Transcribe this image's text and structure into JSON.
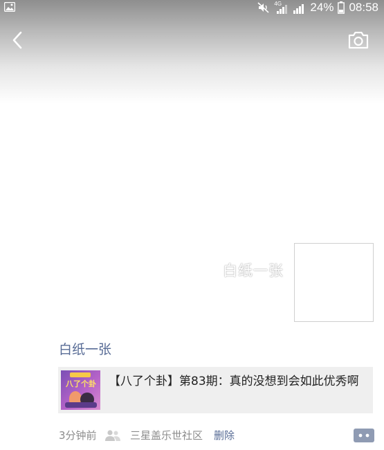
{
  "status_bar": {
    "network": "4G",
    "battery_percent": "24%",
    "time": "08:58",
    "left_icon": "image-icon",
    "icons": [
      "mute-icon",
      "signal-icon",
      "signal-2g-icon",
      "battery-icon"
    ]
  },
  "header": {
    "back_icon": "chevron-left-icon",
    "camera_icon": "camera-icon"
  },
  "cover": {
    "user_name": "白纸一张"
  },
  "post": {
    "author": "白纸一张",
    "share_card": {
      "title": "【八了个卦】第83期：真的没想到会如此优秀啊",
      "thumb_text": "八了个卦"
    },
    "time": "3分钟前",
    "source": "三星盖乐世社区",
    "delete_label": "删除",
    "visibility_icon": "people-icon",
    "comment_icon": "comment-icon"
  },
  "colors": {
    "link": "#576b95",
    "meta": "#8c8c8c",
    "card_bg": "#efefef"
  }
}
